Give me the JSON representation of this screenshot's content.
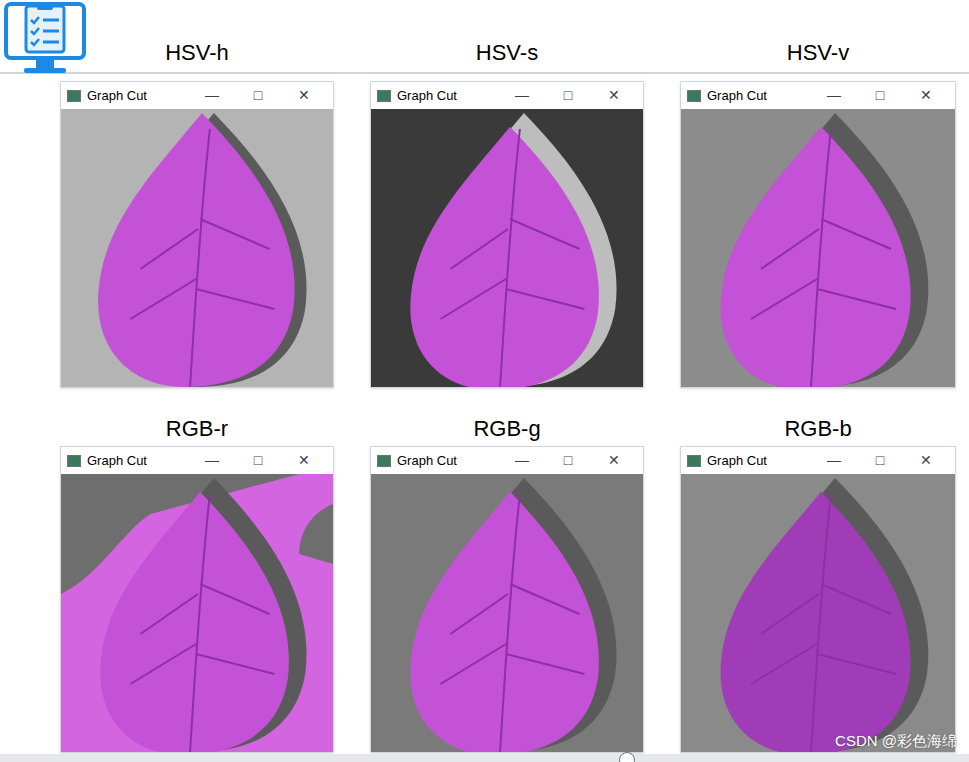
{
  "panels": [
    {
      "label": "HSV-h",
      "window": {
        "title": "Graph Cut",
        "controls": [
          "—",
          "□",
          "✕"
        ]
      }
    },
    {
      "label": "HSV-s",
      "window": {
        "title": "Graph Cut",
        "controls": [
          "—",
          "□",
          "✕"
        ]
      }
    },
    {
      "label": "HSV-v",
      "window": {
        "title": "Graph Cut",
        "controls": [
          "—",
          "□",
          "✕"
        ]
      }
    },
    {
      "label": "RGB-r",
      "window": {
        "title": "Graph Cut",
        "controls": [
          "—",
          "□",
          "✕"
        ]
      }
    },
    {
      "label": "RGB-g",
      "window": {
        "title": "Graph Cut",
        "controls": [
          "—",
          "□",
          "✕"
        ]
      }
    },
    {
      "label": "RGB-b",
      "window": {
        "title": "Graph Cut",
        "controls": [
          "—",
          "□",
          "✕"
        ]
      }
    }
  ],
  "watermark": "CSDN @彩色海绵"
}
